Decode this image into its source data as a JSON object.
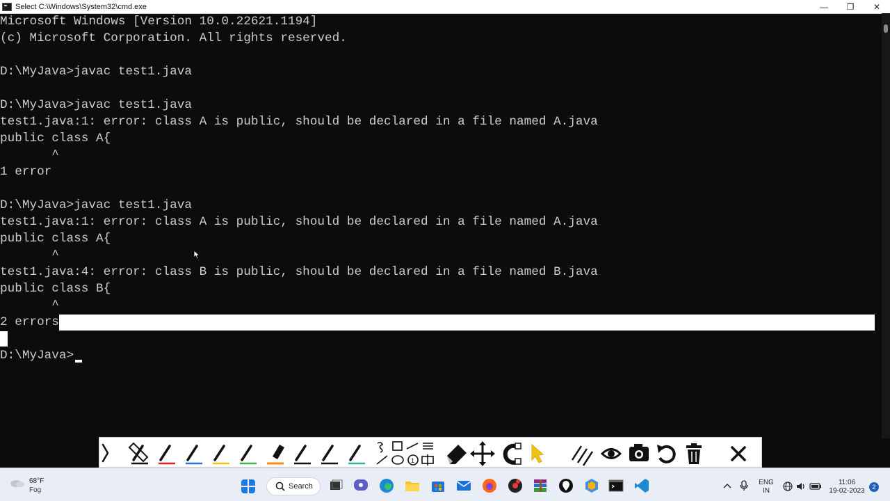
{
  "window": {
    "title": "Select C:\\Windows\\System32\\cmd.exe",
    "minimize": "—",
    "maximize": "❐",
    "close": "✕"
  },
  "console": {
    "lines": [
      "Microsoft Windows [Version 10.0.22621.1194]",
      "(c) Microsoft Corporation. All rights reserved.",
      "",
      "D:\\MyJava>javac test1.java",
      "",
      "D:\\MyJava>javac test1.java",
      "test1.java:1: error: class A is public, should be declared in a file named A.java",
      "public class A{",
      "       ^",
      "1 error",
      "",
      "D:\\MyJava>javac test1.java",
      "test1.java:1: error: class A is public, should be declared in a file named A.java",
      "public class A{",
      "       ^",
      "test1.java:4: error: class B is public, should be declared in a file named B.java",
      "public class B{",
      "       ^",
      "2 errors",
      "",
      "D:\\MyJava>"
    ]
  },
  "annotation_toolbar": {
    "tools": [
      "collapse-arrow",
      "pen-black",
      "pen-red",
      "pen-blue",
      "pen-yellow",
      "pen-green",
      "highlighter-orange",
      "pen-black-2",
      "pen-black-3",
      "pen-teal",
      "shapes",
      "eraser",
      "move",
      "magnet",
      "pointer",
      "lines",
      "eye",
      "camera",
      "undo",
      "delete",
      "close"
    ]
  },
  "taskbar": {
    "weather_temp": "68°F",
    "weather_desc": "Fog",
    "search_label": "Search",
    "lang_top": "ENG",
    "lang_bottom": "IN",
    "time": "11:06",
    "date": "19-02-2023",
    "notification_count": "2"
  }
}
